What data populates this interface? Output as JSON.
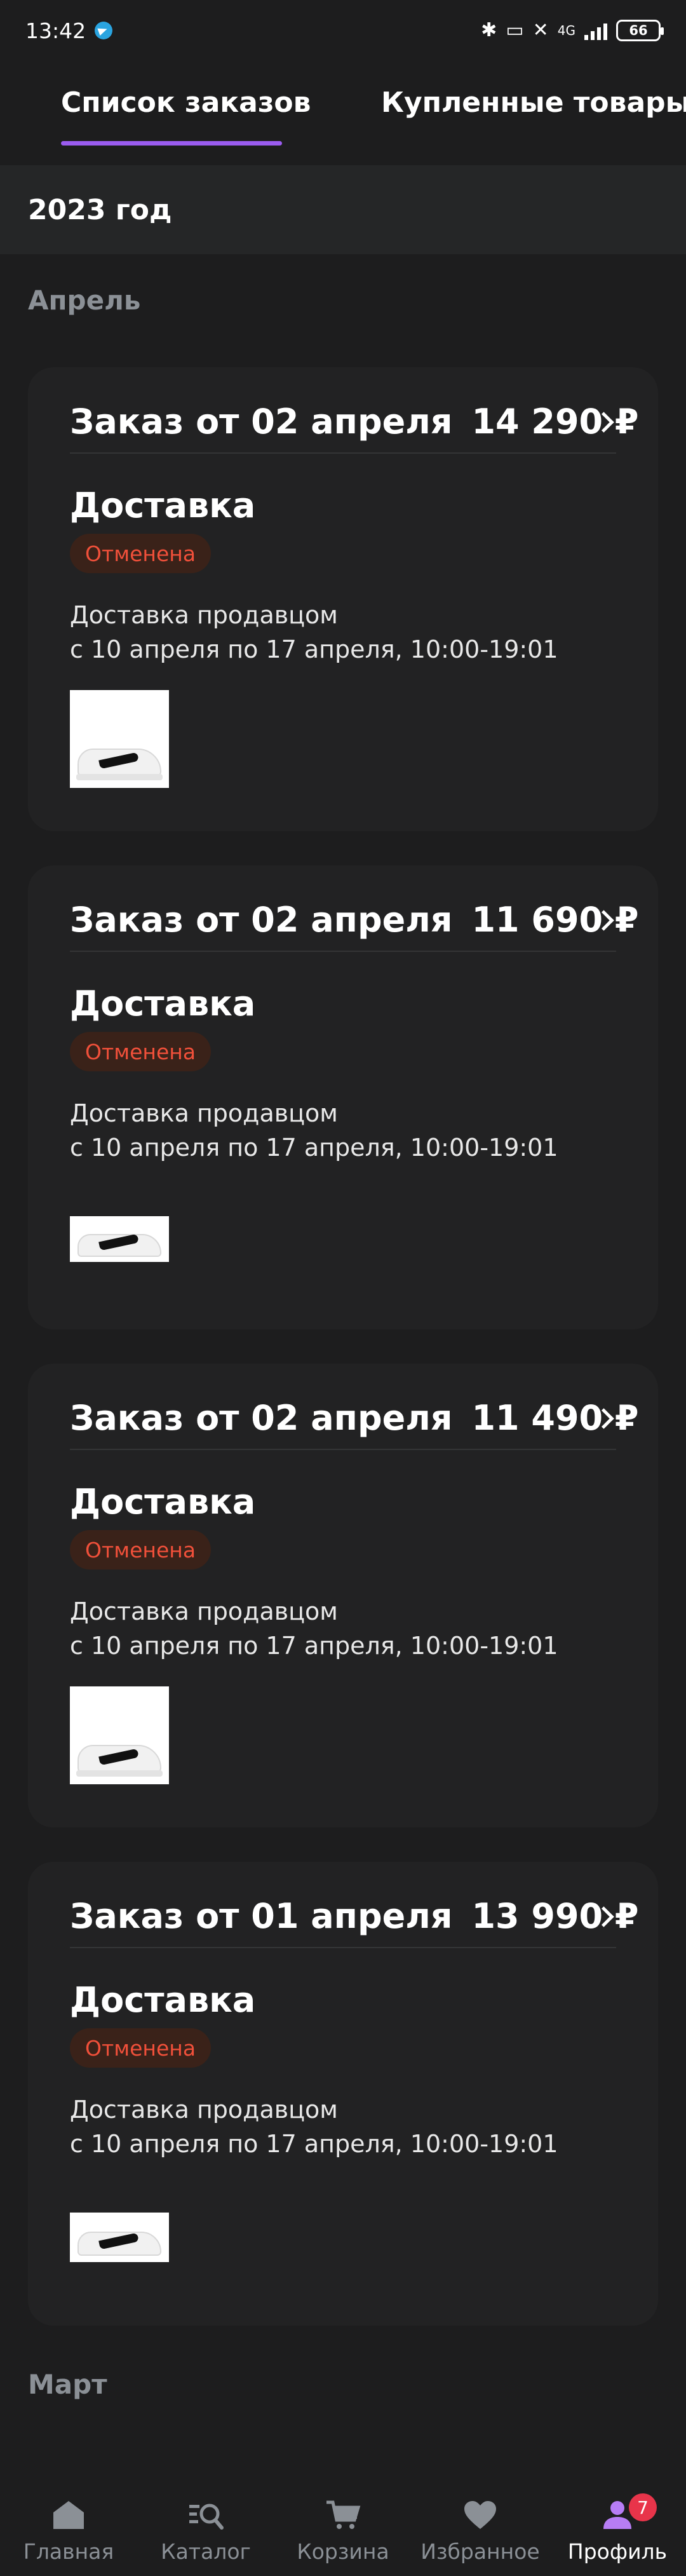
{
  "status_bar": {
    "time": "13:42",
    "network": "4G",
    "battery": "66"
  },
  "tabs": [
    {
      "label": "Список заказов",
      "active": true
    },
    {
      "label": "Купленные товары",
      "active": false
    }
  ],
  "year_header": "2023 год",
  "months": {
    "april": "Апрель",
    "march": "Март"
  },
  "orders": [
    {
      "title": "Заказ от 02 апреля",
      "sum": "14 290 ₽",
      "delivery_title": "Доставка",
      "status": "Отменена",
      "delivery_method": "Доставка продавцом",
      "delivery_window": "с 10 апреля по 17 апреля, 10:00-19:01"
    },
    {
      "title": "Заказ от 02 апреля",
      "sum": "11 690 ₽",
      "delivery_title": "Доставка",
      "status": "Отменена",
      "delivery_method": "Доставка продавцом",
      "delivery_window": "с 10 апреля по 17 апреля, 10:00-19:01"
    },
    {
      "title": "Заказ от 02 апреля",
      "sum": "11 490 ₽",
      "delivery_title": "Доставка",
      "status": "Отменена",
      "delivery_method": "Доставка продавцом",
      "delivery_window": "с 10 апреля по 17 апреля, 10:00-19:01"
    },
    {
      "title": "Заказ от 01 апреля",
      "sum": "13 990 ₽",
      "delivery_title": "Доставка",
      "status": "Отменена",
      "delivery_method": "Доставка продавцом",
      "delivery_window": "с 10 апреля по 17 апреля, 10:00-19:01"
    }
  ],
  "bottom_nav": [
    {
      "label": "Главная",
      "icon": "home-icon"
    },
    {
      "label": "Каталог",
      "icon": "catalog-search-icon"
    },
    {
      "label": "Корзина",
      "icon": "cart-icon"
    },
    {
      "label": "Избранное",
      "icon": "heart-icon"
    },
    {
      "label": "Профиль",
      "icon": "profile-icon",
      "badge": "7",
      "active": true
    }
  ],
  "colors": {
    "background": "#1d1d1e",
    "card": "#222223",
    "accent": "#9b5cf0",
    "status_cancelled": "#f0503a",
    "badge": "#e8344a"
  }
}
